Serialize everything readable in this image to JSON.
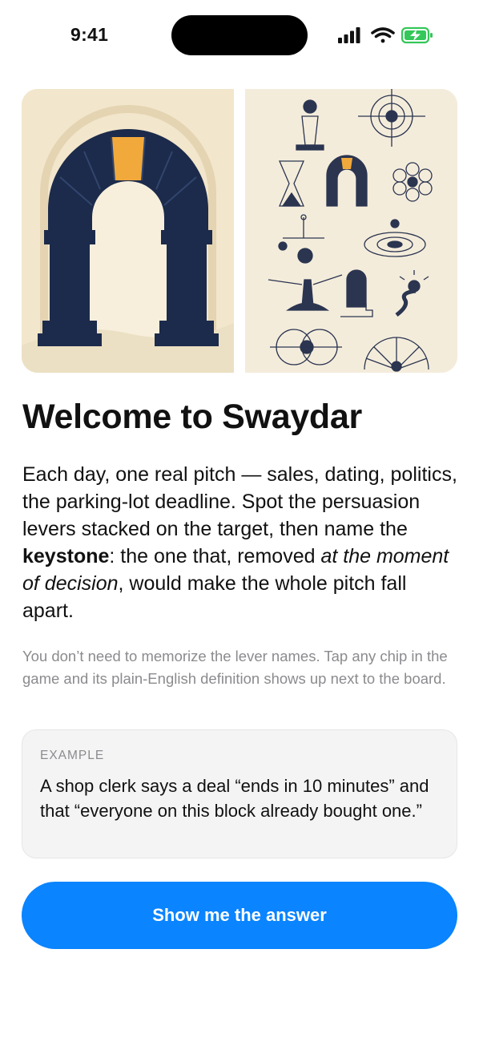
{
  "status_bar": {
    "time": "9:41"
  },
  "colors": {
    "accent": "#0a84ff",
    "navy": "#1c2b4b",
    "gold": "#f2a93b",
    "parchment": "#f3e9d3",
    "battery_green": "#34c759"
  },
  "hero": {
    "left_icon": "archway-keystone-illustration",
    "right_icon": "persuasion-symbols-illustration"
  },
  "intro": {
    "title": "Welcome to Swaydar",
    "body": {
      "p1": "Each day, one real pitch — sales, dating, politics, the parking-lot deadline. Spot the persuasion levers stacked on the target, then name the ",
      "keyword": "keystone",
      "p2": ": the one that, removed ",
      "emphasis": "at the moment of decision",
      "p3": ", would make the whole pitch fall apart."
    },
    "note": "You don’t need to memorize the lever names. Tap any chip in the game and its plain-English definition shows up next to the board."
  },
  "example": {
    "label": "EXAMPLE",
    "text": "A shop clerk says a deal “ends in 10 minutes” and that “everyone on this block already bought one.”"
  },
  "cta": {
    "label": "Show me the answer"
  }
}
